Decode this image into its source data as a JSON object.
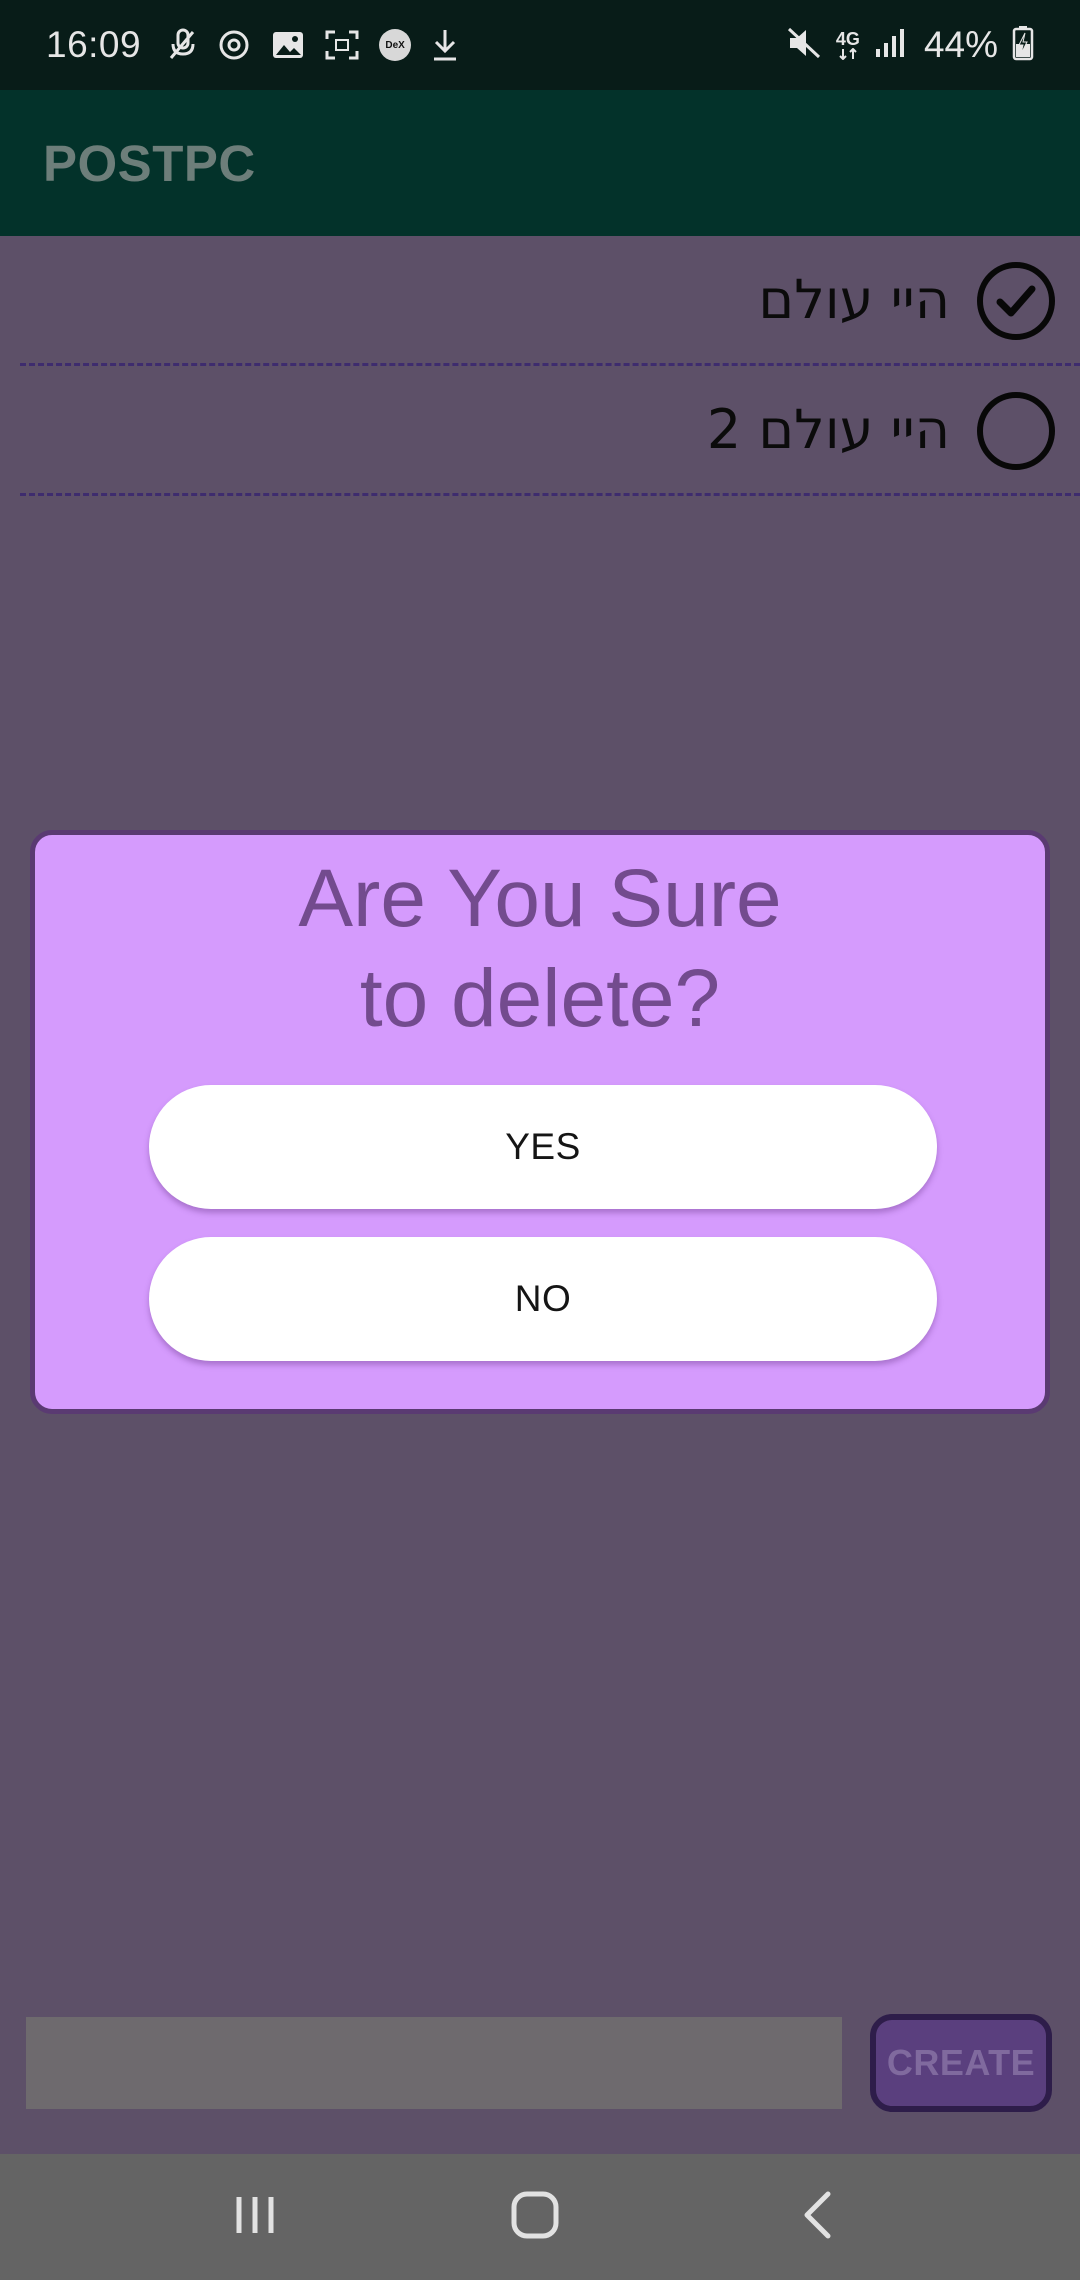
{
  "status_bar": {
    "time": "16:09",
    "network": "4G",
    "battery": "44%"
  },
  "app_bar": {
    "title": "POSTPC"
  },
  "todos": [
    {
      "text": "היי עולם",
      "done": true
    },
    {
      "text": "היי עולם 2",
      "done": false
    }
  ],
  "dialog": {
    "title_line1": "Are You Sure",
    "title_line2": "to delete?",
    "yes_label": "YES",
    "no_label": "NO"
  },
  "input": {
    "value": "",
    "placeholder": ""
  },
  "create_button": {
    "label": "CREATE"
  },
  "colors": {
    "status_bar": "#081c18",
    "app_bar": "#03322a",
    "dimmed_background": "#5d5068",
    "dialog_background": "#d59bfd",
    "dialog_title": "#734b8e",
    "nav_bar": "#646464"
  }
}
